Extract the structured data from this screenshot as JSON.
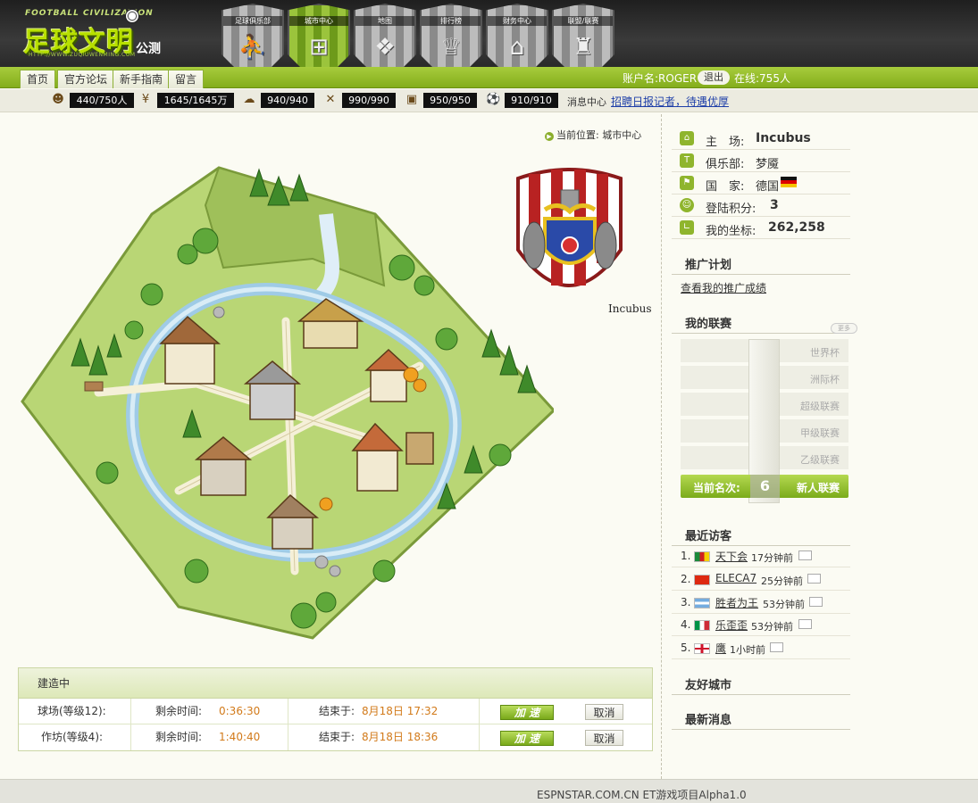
{
  "header": {
    "logo_small": "FOOTBALL CIVILIZATION",
    "logo_main": "足球文明",
    "logo_beta": "公测",
    "logo_url": "HTTP://WWW.ZUQIUWENMING.COM",
    "shields": [
      {
        "label": "足球俱乐部",
        "icon": "player"
      },
      {
        "label": "城市中心",
        "icon": "field"
      },
      {
        "label": "地图",
        "icon": "map"
      },
      {
        "label": "排行榜",
        "icon": "trophy"
      },
      {
        "label": "财务中心",
        "icon": "bank"
      },
      {
        "label": "联盟/联赛",
        "icon": "castle"
      }
    ]
  },
  "nav": {
    "tabs": [
      "首页",
      "官方论坛",
      "新手指南",
      "留言"
    ],
    "account_label": "账户名:ROGER",
    "logout": "退出",
    "online": "在线:755人"
  },
  "resources": [
    {
      "icon": "players",
      "value": "440/750人"
    },
    {
      "icon": "money",
      "value": "1645/1645万"
    },
    {
      "icon": "cloud",
      "value": "940/940"
    },
    {
      "icon": "wood",
      "value": "990/990"
    },
    {
      "icon": "bucket",
      "value": "950/950"
    },
    {
      "icon": "ball",
      "value": "910/910"
    }
  ],
  "messages": {
    "label": "消息中心",
    "link": "招聘日报记者，待遇优厚"
  },
  "location": "当前位置: 城市中心",
  "crest_name": "Incubus",
  "building": {
    "title": "建造中",
    "rows": [
      {
        "name": "球场(等级12):",
        "remain_label": "剩余时间:",
        "remain": "0:36:30",
        "end_label": "结束于:",
        "end": "8月18日 17:32",
        "speed": "加 速",
        "cancel": "取消"
      },
      {
        "name": "作坊(等级4):",
        "remain_label": "剩余时间:",
        "remain": "1:40:40",
        "end_label": "结束于:",
        "end": "8月18日 18:36",
        "speed": "加 速",
        "cancel": "取消"
      }
    ]
  },
  "info": {
    "stadium_label": "主　场:",
    "stadium": "Incubus",
    "club_label": "俱乐部:",
    "club": "梦魇",
    "country_label": "国　家:",
    "country": "德国",
    "points_label": "登陆积分:",
    "points": "3",
    "coords_label": "我的坐标:",
    "coords": "262,258"
  },
  "promo": {
    "title": "推广计划",
    "link": "查看我的推广成绩"
  },
  "league": {
    "title": "我的联赛",
    "more": "更多",
    "items": [
      "世界杯",
      "洲际杯",
      "超级联赛",
      "甲级联赛",
      "乙级联赛"
    ],
    "rank_label": "当前名次:",
    "rank": "6",
    "current": "新人联赛"
  },
  "visitors": {
    "title": "最近访客",
    "list": [
      {
        "num": "1.",
        "flag": "cameroon",
        "name": "天下会",
        "time": "17分钟前"
      },
      {
        "num": "2.",
        "flag": "china",
        "name": "ELECA7",
        "time": "25分钟前"
      },
      {
        "num": "3.",
        "flag": "argentina",
        "name": "胜者为王",
        "time": "53分钟前"
      },
      {
        "num": "4.",
        "flag": "italy",
        "name": "乐歪歪",
        "time": "53分钟前"
      },
      {
        "num": "5.",
        "flag": "england",
        "name": "鹰",
        "time": "1小时前"
      }
    ]
  },
  "friendly_city": "友好城市",
  "latest_news": "最新消息",
  "footer": "ESPNSTAR.COM.CN ET游戏项目Alpha1.0",
  "colors": {
    "accent": "#8fb52d",
    "orange": "#d27a1a",
    "link": "#1e3fa8"
  }
}
